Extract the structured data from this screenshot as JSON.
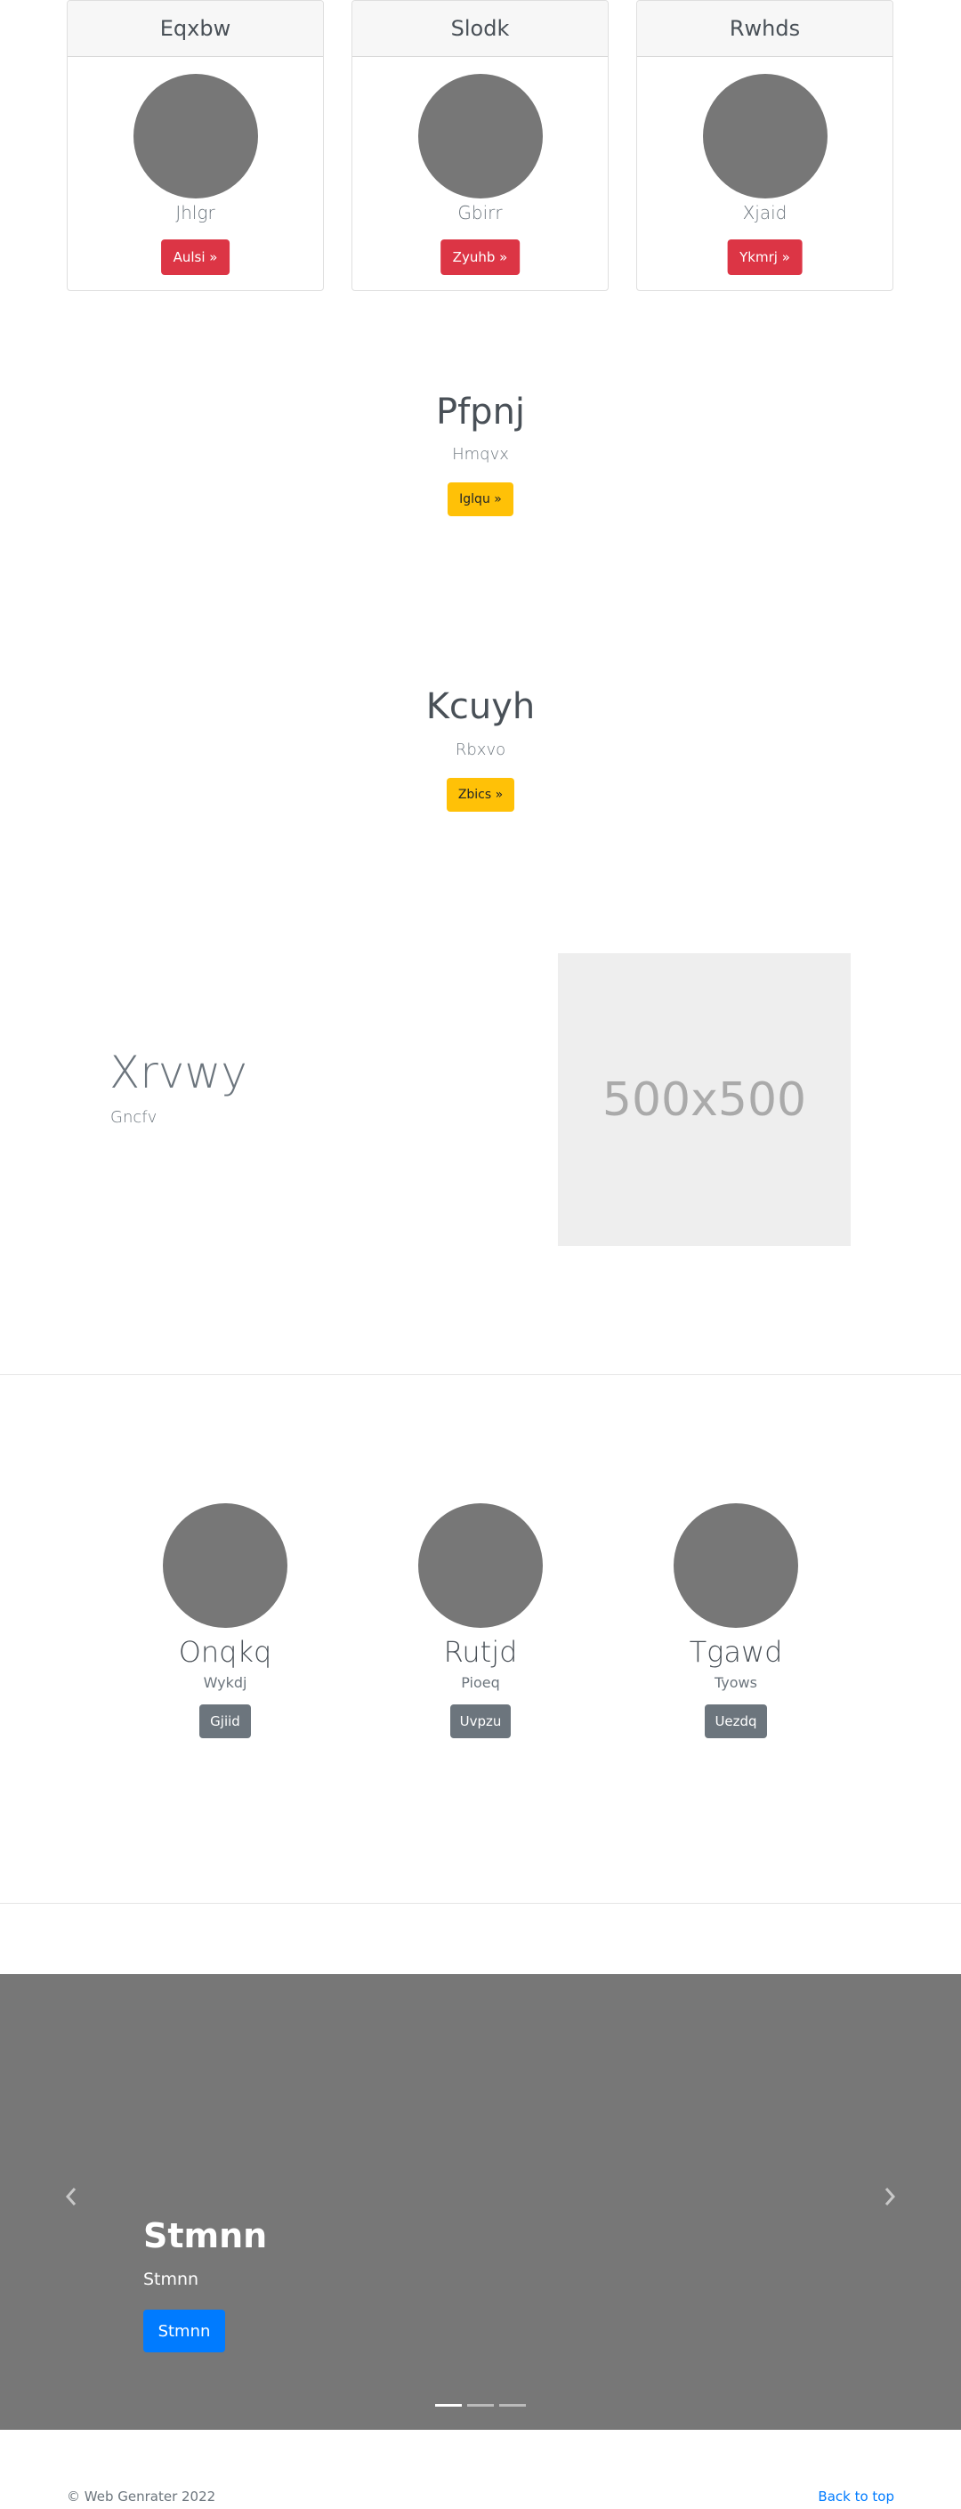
{
  "pricing": [
    {
      "header": "Eqxbw",
      "name": "Jhlgr",
      "button": "Aulsi »"
    },
    {
      "header": "Slodk",
      "name": "Gbirr",
      "button": "Zyuhb »"
    },
    {
      "header": "Rwhds",
      "name": "Xjaid",
      "button": "Ykmrj »"
    }
  ],
  "section_a": {
    "title": "Pfpnj",
    "subtitle": "Hmqvx",
    "button": "Iglqu »"
  },
  "section_b": {
    "title": "Kcuyh",
    "subtitle": "Rbxvo",
    "button": "Zbics »"
  },
  "featurette": {
    "heading": "Xrvwy",
    "lead": "Gncfv",
    "placeholder_label": "500x500"
  },
  "features": [
    {
      "name": "Onqkq",
      "subtitle": "Wykdj",
      "button": "Gjiid"
    },
    {
      "name": "Rutjd",
      "subtitle": "Pioeq",
      "button": "Uvpzu"
    },
    {
      "name": "Tgawd",
      "subtitle": "Tyows",
      "button": "Uezdq"
    }
  ],
  "carousel": {
    "title": "Stmnn",
    "caption": "Stmnn",
    "button": "Stmnn",
    "slides": 3,
    "active_slide": 1
  },
  "footer": {
    "copyright": "© Web Genrater 2022",
    "back_to_top": "Back to top"
  },
  "icons": {
    "prev": "chevron-left-icon",
    "next": "chevron-right-icon"
  },
  "colors": {
    "danger": "#dc3545",
    "warning": "#ffc107",
    "secondary": "#6c757d",
    "primary": "#007bff",
    "link": "#007bff",
    "placeholder": "#777777"
  }
}
